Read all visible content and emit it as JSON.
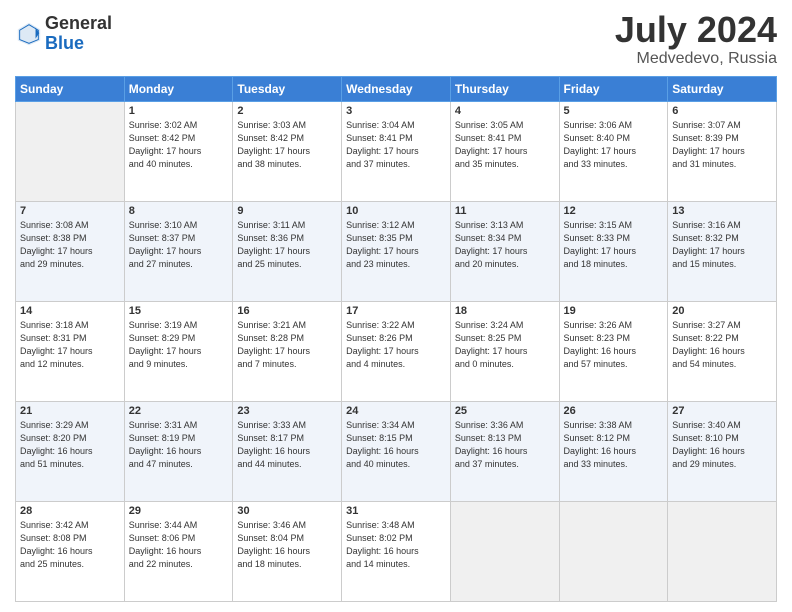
{
  "logo": {
    "general": "General",
    "blue": "Blue"
  },
  "header": {
    "month": "July 2024",
    "location": "Medvedevo, Russia"
  },
  "days_of_week": [
    "Sunday",
    "Monday",
    "Tuesday",
    "Wednesday",
    "Thursday",
    "Friday",
    "Saturday"
  ],
  "weeks": [
    [
      {
        "day": "",
        "info": ""
      },
      {
        "day": "1",
        "info": "Sunrise: 3:02 AM\nSunset: 8:42 PM\nDaylight: 17 hours\nand 40 minutes."
      },
      {
        "day": "2",
        "info": "Sunrise: 3:03 AM\nSunset: 8:42 PM\nDaylight: 17 hours\nand 38 minutes."
      },
      {
        "day": "3",
        "info": "Sunrise: 3:04 AM\nSunset: 8:41 PM\nDaylight: 17 hours\nand 37 minutes."
      },
      {
        "day": "4",
        "info": "Sunrise: 3:05 AM\nSunset: 8:41 PM\nDaylight: 17 hours\nand 35 minutes."
      },
      {
        "day": "5",
        "info": "Sunrise: 3:06 AM\nSunset: 8:40 PM\nDaylight: 17 hours\nand 33 minutes."
      },
      {
        "day": "6",
        "info": "Sunrise: 3:07 AM\nSunset: 8:39 PM\nDaylight: 17 hours\nand 31 minutes."
      }
    ],
    [
      {
        "day": "7",
        "info": "Sunrise: 3:08 AM\nSunset: 8:38 PM\nDaylight: 17 hours\nand 29 minutes."
      },
      {
        "day": "8",
        "info": "Sunrise: 3:10 AM\nSunset: 8:37 PM\nDaylight: 17 hours\nand 27 minutes."
      },
      {
        "day": "9",
        "info": "Sunrise: 3:11 AM\nSunset: 8:36 PM\nDaylight: 17 hours\nand 25 minutes."
      },
      {
        "day": "10",
        "info": "Sunrise: 3:12 AM\nSunset: 8:35 PM\nDaylight: 17 hours\nand 23 minutes."
      },
      {
        "day": "11",
        "info": "Sunrise: 3:13 AM\nSunset: 8:34 PM\nDaylight: 17 hours\nand 20 minutes."
      },
      {
        "day": "12",
        "info": "Sunrise: 3:15 AM\nSunset: 8:33 PM\nDaylight: 17 hours\nand 18 minutes."
      },
      {
        "day": "13",
        "info": "Sunrise: 3:16 AM\nSunset: 8:32 PM\nDaylight: 17 hours\nand 15 minutes."
      }
    ],
    [
      {
        "day": "14",
        "info": "Sunrise: 3:18 AM\nSunset: 8:31 PM\nDaylight: 17 hours\nand 12 minutes."
      },
      {
        "day": "15",
        "info": "Sunrise: 3:19 AM\nSunset: 8:29 PM\nDaylight: 17 hours\nand 9 minutes."
      },
      {
        "day": "16",
        "info": "Sunrise: 3:21 AM\nSunset: 8:28 PM\nDaylight: 17 hours\nand 7 minutes."
      },
      {
        "day": "17",
        "info": "Sunrise: 3:22 AM\nSunset: 8:26 PM\nDaylight: 17 hours\nand 4 minutes."
      },
      {
        "day": "18",
        "info": "Sunrise: 3:24 AM\nSunset: 8:25 PM\nDaylight: 17 hours\nand 0 minutes."
      },
      {
        "day": "19",
        "info": "Sunrise: 3:26 AM\nSunset: 8:23 PM\nDaylight: 16 hours\nand 57 minutes."
      },
      {
        "day": "20",
        "info": "Sunrise: 3:27 AM\nSunset: 8:22 PM\nDaylight: 16 hours\nand 54 minutes."
      }
    ],
    [
      {
        "day": "21",
        "info": "Sunrise: 3:29 AM\nSunset: 8:20 PM\nDaylight: 16 hours\nand 51 minutes."
      },
      {
        "day": "22",
        "info": "Sunrise: 3:31 AM\nSunset: 8:19 PM\nDaylight: 16 hours\nand 47 minutes."
      },
      {
        "day": "23",
        "info": "Sunrise: 3:33 AM\nSunset: 8:17 PM\nDaylight: 16 hours\nand 44 minutes."
      },
      {
        "day": "24",
        "info": "Sunrise: 3:34 AM\nSunset: 8:15 PM\nDaylight: 16 hours\nand 40 minutes."
      },
      {
        "day": "25",
        "info": "Sunrise: 3:36 AM\nSunset: 8:13 PM\nDaylight: 16 hours\nand 37 minutes."
      },
      {
        "day": "26",
        "info": "Sunrise: 3:38 AM\nSunset: 8:12 PM\nDaylight: 16 hours\nand 33 minutes."
      },
      {
        "day": "27",
        "info": "Sunrise: 3:40 AM\nSunset: 8:10 PM\nDaylight: 16 hours\nand 29 minutes."
      }
    ],
    [
      {
        "day": "28",
        "info": "Sunrise: 3:42 AM\nSunset: 8:08 PM\nDaylight: 16 hours\nand 25 minutes."
      },
      {
        "day": "29",
        "info": "Sunrise: 3:44 AM\nSunset: 8:06 PM\nDaylight: 16 hours\nand 22 minutes."
      },
      {
        "day": "30",
        "info": "Sunrise: 3:46 AM\nSunset: 8:04 PM\nDaylight: 16 hours\nand 18 minutes."
      },
      {
        "day": "31",
        "info": "Sunrise: 3:48 AM\nSunset: 8:02 PM\nDaylight: 16 hours\nand 14 minutes."
      },
      {
        "day": "",
        "info": ""
      },
      {
        "day": "",
        "info": ""
      },
      {
        "day": "",
        "info": ""
      }
    ]
  ]
}
